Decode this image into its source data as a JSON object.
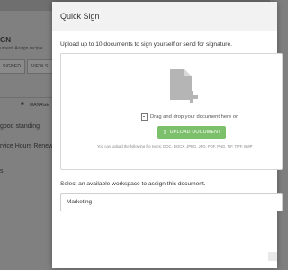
{
  "background": {
    "heading_fragment": "GN",
    "subtext_fragment": "ument. Assign recipie",
    "btn_signed": "SIGNED",
    "btn_view": "VIEW SI",
    "manage_label": "MANAGE",
    "row1": "good standing",
    "row2": "rvice Hours Renewal",
    "row3": "s"
  },
  "modal": {
    "title": "Quick Sign",
    "instruction": "Upload up to 10 documents to sign yourself or send for signature.",
    "drag_text": "Drag and drop your document here or",
    "upload_button": "UPLOAD DOCUMENT",
    "filetypes_text": "You can upload the following file types: DOC, DOCX, JPEG, JPG, PDF, PNG, TIF, TIFF, BMP",
    "workspace_label": "Select an available workspace to assign this document.",
    "workspace_value": "Marketing"
  },
  "icons": {
    "document_add": "document-add-icon",
    "small_document": "document-icon",
    "upload": "upload-icon",
    "manage": "folder-icon"
  },
  "colors": {
    "upload_button": "#7dc06c",
    "overlay": "#808080"
  }
}
